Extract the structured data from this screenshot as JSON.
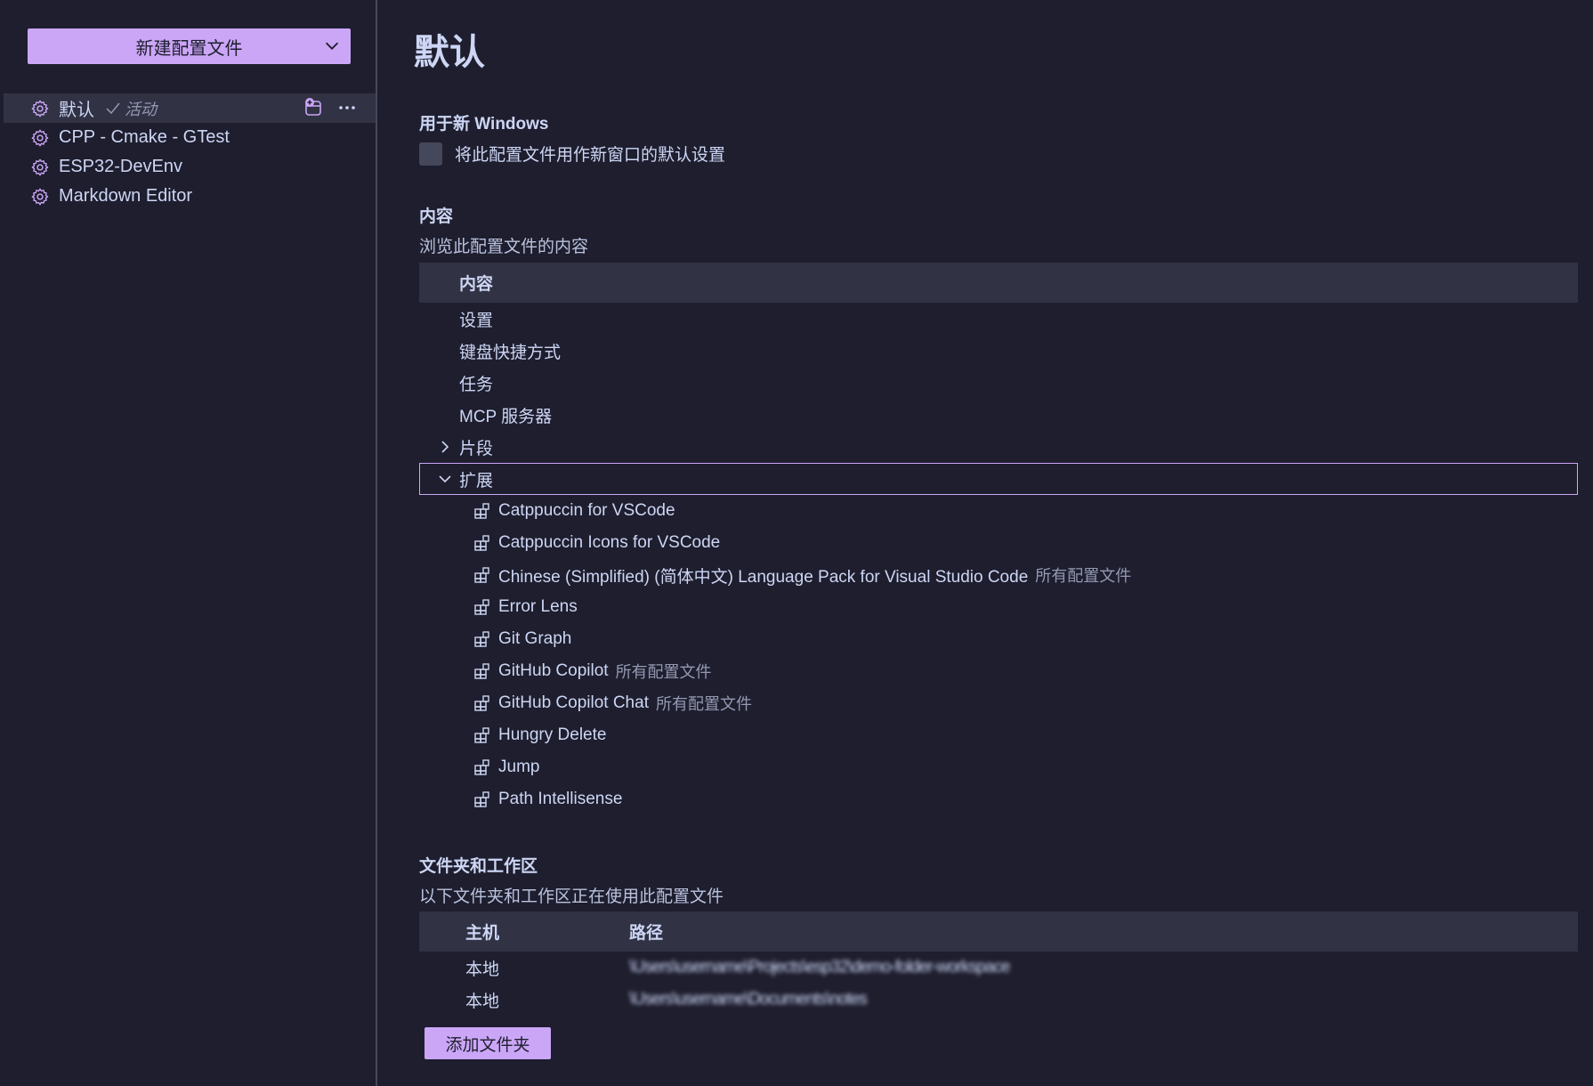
{
  "sidebar": {
    "new_profile_button": "新建配置文件",
    "profiles": [
      {
        "name": "默认",
        "active_label": "活动"
      },
      {
        "name": "CPP - Cmake - GTest"
      },
      {
        "name": "ESP32-DevEnv"
      },
      {
        "name": "Markdown Editor"
      }
    ]
  },
  "main": {
    "title": "默认",
    "new_windows": {
      "title": "用于新 Windows",
      "checkbox_label": "将此配置文件用作新窗口的默认设置"
    },
    "contents": {
      "title": "内容",
      "description": "浏览此配置文件的内容",
      "tree_header": "内容",
      "items": [
        "设置",
        "键盘快捷方式",
        "任务",
        "MCP 服务器"
      ],
      "snippets_label": "片段",
      "extensions_label": "扩展",
      "extensions": [
        {
          "name": "Catppuccin for VSCode",
          "scope": ""
        },
        {
          "name": "Catppuccin Icons for VSCode",
          "scope": ""
        },
        {
          "name": "Chinese (Simplified) (简体中文) Language Pack for Visual Studio Code",
          "scope": "所有配置文件"
        },
        {
          "name": "Error Lens",
          "scope": ""
        },
        {
          "name": "Git Graph",
          "scope": ""
        },
        {
          "name": "GitHub Copilot",
          "scope": "所有配置文件"
        },
        {
          "name": "GitHub Copilot Chat",
          "scope": "所有配置文件"
        },
        {
          "name": "Hungry Delete",
          "scope": ""
        },
        {
          "name": "Jump",
          "scope": ""
        },
        {
          "name": "Path Intellisense",
          "scope": ""
        }
      ]
    },
    "workspaces": {
      "title": "文件夹和工作区",
      "description": "以下文件夹和工作区正在使用此配置文件",
      "col_host": "主机",
      "col_path": "路径",
      "rows": [
        {
          "host": "本地",
          "path": "\\Users\\username\\Projects\\esp32\\demo-folder-workspace"
        },
        {
          "host": "本地",
          "path": "\\Users\\username\\Documents\\notes"
        }
      ],
      "add_folder_button": "添加文件夹"
    }
  },
  "colors": {
    "background": "#1e1e2e",
    "accent": "#cba6f7",
    "surface": "#313244",
    "text": "#cdd6f4",
    "muted": "#9399b2"
  }
}
